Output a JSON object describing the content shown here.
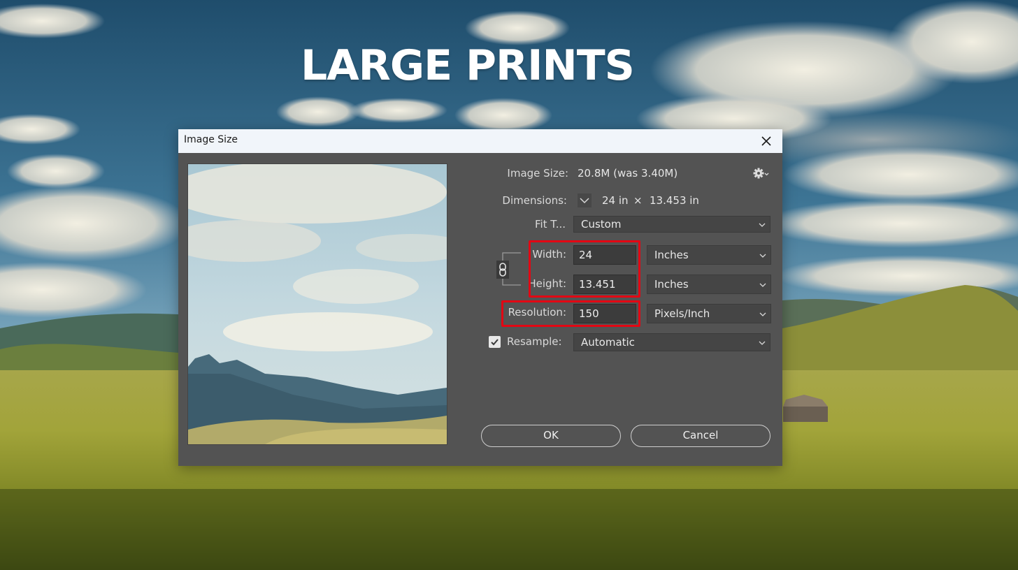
{
  "headline": "LARGE PRINTS",
  "dialog": {
    "title": "Image Size",
    "image_size_label": "Image Size:",
    "image_size_value": "20.8M (was 3.40M)",
    "dimensions_label": "Dimensions:",
    "dimensions_width": "24 in",
    "dimensions_times": "×",
    "dimensions_height": "13.453 in",
    "fit_to_label": "Fit T...",
    "fit_to_value": "Custom",
    "width_label": "Width:",
    "width_value": "24",
    "width_unit": "Inches",
    "height_label": "Height:",
    "height_value": "13.451",
    "height_unit": "Inches",
    "resolution_label": "Resolution:",
    "resolution_value": "150",
    "resolution_unit": "Pixels/Inch",
    "resample_label": "Resample:",
    "resample_checked": true,
    "resample_value": "Automatic",
    "ok_label": "OK",
    "cancel_label": "Cancel"
  },
  "icons": {
    "close": "close-icon",
    "settings": "gear-icon",
    "dimensions_toggle": "chevron-down-icon",
    "constrain": "chain-link-icon",
    "checkbox": "checkmark-icon"
  },
  "colors": {
    "dialog_bg": "#535353",
    "titlebar_bg": "#f1f5fa",
    "highlight": "#e30613",
    "field_bg": "#3c3c3c"
  }
}
